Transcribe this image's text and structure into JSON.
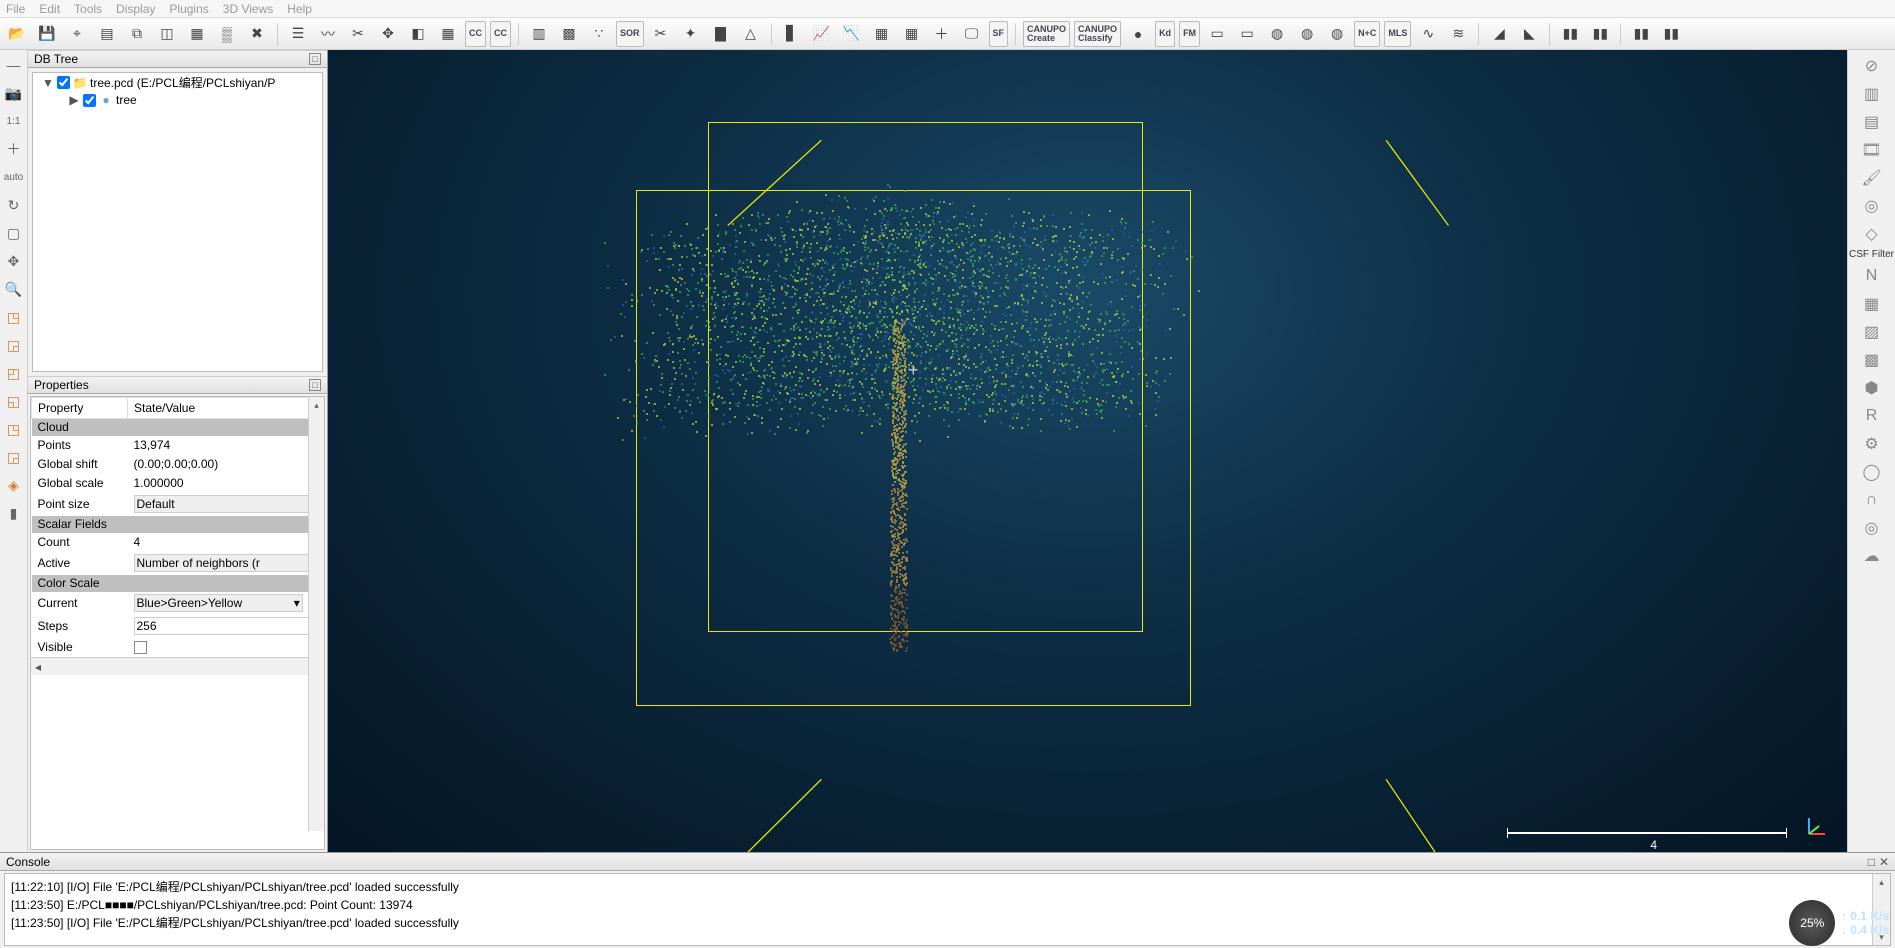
{
  "menu": {
    "items": [
      "File",
      "Edit",
      "Tools",
      "Display",
      "Plugins",
      "3D Views",
      "Help"
    ]
  },
  "toolbar_icons": [
    {
      "n": "open-icon",
      "g": "📂"
    },
    {
      "n": "save-icon",
      "g": "💾"
    },
    {
      "n": "pick-icon",
      "g": "⌖"
    },
    {
      "n": "levels-icon",
      "g": "▤"
    },
    {
      "n": "clone-icon",
      "g": "⧉"
    },
    {
      "n": "merge-icon",
      "g": "◫"
    },
    {
      "n": "rgb-icon",
      "g": "▦"
    },
    {
      "n": "subsample-icon",
      "g": "▒"
    },
    {
      "n": "delete-icon",
      "g": "✖"
    },
    {
      "n": "sep"
    },
    {
      "n": "point-list-icon",
      "g": "☰"
    },
    {
      "n": "trace-icon",
      "g": "〰"
    },
    {
      "n": "segment-icon",
      "g": "✂"
    },
    {
      "n": "translate-icon",
      "g": "✥"
    },
    {
      "n": "section-icon",
      "g": "◧"
    },
    {
      "n": "rasterize-icon",
      "g": "▦"
    },
    {
      "n": "cc-icon",
      "g": "CC",
      "cls": "tlbl"
    },
    {
      "n": "cc2-icon",
      "g": "CC",
      "cls": "tlbl"
    },
    {
      "n": "sep"
    },
    {
      "n": "colorize-icon",
      "g": "▥"
    },
    {
      "n": "checker-icon",
      "g": "▩"
    },
    {
      "n": "noise-icon",
      "g": "∵"
    },
    {
      "n": "sor-icon",
      "g": "SOR",
      "cls": "tlbl"
    },
    {
      "n": "scissors-icon",
      "g": "✂"
    },
    {
      "n": "trihedron-icon",
      "g": "✦"
    },
    {
      "n": "colorblock-icon",
      "g": "▇"
    },
    {
      "n": "normals-icon",
      "g": "△"
    },
    {
      "n": "sep"
    },
    {
      "n": "histogram-icon",
      "g": "▋"
    },
    {
      "n": "stat1-icon",
      "g": "📈"
    },
    {
      "n": "stat2-icon",
      "g": "📉"
    },
    {
      "n": "grid1-icon",
      "g": "▦"
    },
    {
      "n": "grid2-icon",
      "g": "▦"
    },
    {
      "n": "add-icon",
      "g": "＋"
    },
    {
      "n": "screen-icon",
      "g": "🖵"
    },
    {
      "n": "sf-icon",
      "g": "SF",
      "cls": "tlbl"
    },
    {
      "n": "sep"
    },
    {
      "n": "canupo-train-icon",
      "g": "CANUPO\\nCreate",
      "cls": "tlbl"
    },
    {
      "n": "canupo-classify-icon",
      "g": "CANUPO\\nClassify",
      "cls": "tlbl"
    },
    {
      "n": "globe1-icon",
      "g": "●"
    },
    {
      "n": "kd-icon",
      "g": "Kd",
      "cls": "tlbl"
    },
    {
      "n": "fm-icon",
      "g": "FM",
      "cls": "tlbl"
    },
    {
      "n": "shp-icon",
      "g": "▭"
    },
    {
      "n": "csv-icon",
      "g": "▭"
    },
    {
      "n": "globe2-icon",
      "g": "◍"
    },
    {
      "n": "globe3-icon",
      "g": "◍"
    },
    {
      "n": "globe4-icon",
      "g": "◍"
    },
    {
      "n": "nc-icon",
      "g": "N+C",
      "cls": "tlbl"
    },
    {
      "n": "mls-icon",
      "g": "MLS",
      "cls": "tlbl"
    },
    {
      "n": "curve1-icon",
      "g": "∿"
    },
    {
      "n": "curve2-icon",
      "g": "≋"
    },
    {
      "n": "sep"
    },
    {
      "n": "cloud1-icon",
      "g": "◢"
    },
    {
      "n": "cloud2-icon",
      "g": "◣"
    },
    {
      "n": "sep"
    },
    {
      "n": "books1-icon",
      "g": "▮▮"
    },
    {
      "n": "books2-icon",
      "g": "▮▮"
    },
    {
      "n": "sep"
    },
    {
      "n": "books3-icon",
      "g": "▮▮"
    },
    {
      "n": "books4-icon",
      "g": "▮▮"
    }
  ],
  "left_icons": [
    {
      "n": "dash-icon",
      "g": "—"
    },
    {
      "n": "camera-icon",
      "g": "📷"
    },
    {
      "n": "ratio-icon",
      "g": "1:1"
    },
    {
      "n": "plus-icon",
      "g": "＋"
    },
    {
      "n": "auto-icon",
      "g": "auto"
    },
    {
      "n": "rotate-icon",
      "g": "↻"
    },
    {
      "n": "wire-icon",
      "g": "▢"
    },
    {
      "n": "move-icon",
      "g": "✥"
    },
    {
      "n": "zoom-icon",
      "g": "🔍"
    },
    {
      "n": "cube-top-icon",
      "g": "◳"
    },
    {
      "n": "cube-bottom-icon",
      "g": "◲"
    },
    {
      "n": "cube-left-icon",
      "g": "◰"
    },
    {
      "n": "cube-right-icon",
      "g": "◱"
    },
    {
      "n": "cube-front-icon",
      "g": "◳"
    },
    {
      "n": "cube-back-icon",
      "g": "◲"
    },
    {
      "n": "cube-iso-icon",
      "g": "◈"
    },
    {
      "n": "colorbar-icon",
      "g": "▮"
    }
  ],
  "right_icons": [
    {
      "n": "ban-icon",
      "g": "⊘"
    },
    {
      "n": "sfon-icon",
      "g": "▥"
    },
    {
      "n": "sfoff-icon",
      "g": "▤"
    },
    {
      "n": "film-icon",
      "g": "🎞"
    },
    {
      "n": "brush-icon",
      "g": "🖌"
    },
    {
      "n": "compass-icon",
      "g": "◎"
    },
    {
      "n": "shield-icon",
      "g": "◇"
    },
    {
      "n": "csf-label",
      "g": "CSF Filter",
      "lbl": true
    },
    {
      "n": "n-icon",
      "g": "N"
    },
    {
      "n": "hpr-icon",
      "g": "▦"
    },
    {
      "n": "m3c2-icon",
      "g": "▨"
    },
    {
      "n": "pcv-icon",
      "g": "▩"
    },
    {
      "n": "hex-icon",
      "g": "⬢"
    },
    {
      "n": "ransac-icon",
      "g": "R"
    },
    {
      "n": "gear-icon",
      "g": "⚙"
    },
    {
      "n": "ring-icon",
      "g": "◯"
    },
    {
      "n": "horseshoe-icon",
      "g": "∩"
    },
    {
      "n": "target-icon",
      "g": "◎"
    },
    {
      "n": "cloudup-icon",
      "g": "☁"
    }
  ],
  "db": {
    "title": "DB Tree",
    "root": {
      "label": "tree.pcd  (E:/PCL编程/PCLshiyan/P",
      "checked": true
    },
    "child": {
      "label": "tree",
      "checked": true
    }
  },
  "props": {
    "title": "Properties",
    "headers": {
      "k": "Property",
      "v": "State/Value"
    },
    "sections": {
      "cloud": "Cloud",
      "scalar": "Scalar Fields",
      "color": "Color Scale"
    },
    "rows": {
      "points_k": "Points",
      "points_v": "13,974",
      "shift_k": "Global shift",
      "shift_v": "(0.00;0.00;0.00)",
      "scale_k": "Global scale",
      "scale_v": "1.000000",
      "psize_k": "Point size",
      "psize_v": "Default",
      "count_k": "Count",
      "count_v": "4",
      "active_k": "Active",
      "active_v": "Number of neighbors (r",
      "current_k": "Current",
      "current_v": "Blue>Green>Yellow",
      "steps_k": "Steps",
      "steps_v": "256",
      "visible_k": "Visible"
    }
  },
  "view": {
    "scale_label": "4"
  },
  "console": {
    "title": "Console",
    "lines": [
      "[11:22:10] [I/O] File 'E:/PCL编程/PCLshiyan/PCLshiyan/tree.pcd' loaded successfully",
      "[11:23:50] E:/PCL■■■■/PCLshiyan/PCLshiyan/tree.pcd: Point Count: 13974",
      "[11:23:50] [I/O] File 'E:/PCL编程/PCLshiyan/PCLshiyan/tree.pcd' loaded successfully"
    ]
  },
  "overlay": {
    "pct": "25%",
    "up": "0.1 K/s",
    "down": "0.4 K/s"
  }
}
